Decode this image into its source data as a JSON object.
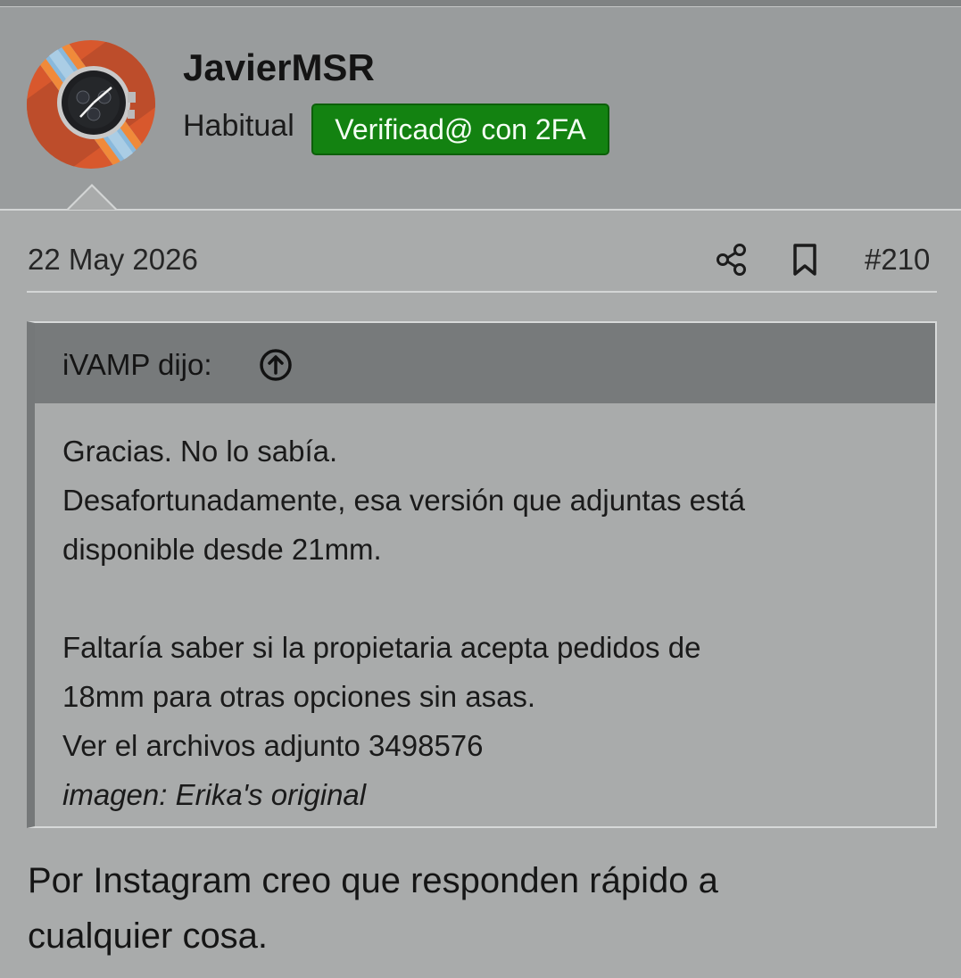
{
  "post": {
    "user": {
      "name": "JavierMSR",
      "title": "Habitual",
      "badge": "Verificad@ con 2FA",
      "badge_color": "#138211",
      "avatar_icon": "avatar"
    },
    "date": "22 May 2026",
    "share_icon": "share-icon",
    "bookmark_icon": "bookmark-icon",
    "number": "#210",
    "quote": {
      "author": "iVAMP dijo:",
      "jump_icon": "arrow-up-circle-icon",
      "lines": [
        "Gracias. No lo sabía.",
        "Desafortunadamente, esa versión que adjuntas está",
        "disponible desde 21mm.",
        "Faltaría saber si la propietaria acepta pedidos de",
        "18mm para otras opciones sin asas.",
        "Ver el archivos adjunto 3498576"
      ],
      "caption": "imagen: Erika's original"
    },
    "reply_lines": [
      "Por Instagram creo que responden rápido a",
      "cualquier cosa."
    ]
  },
  "colors": {
    "header_background": "#999c9d",
    "page_background": "#a9abab",
    "quote_header": "#777a7b",
    "quote_accent": "#757879"
  }
}
